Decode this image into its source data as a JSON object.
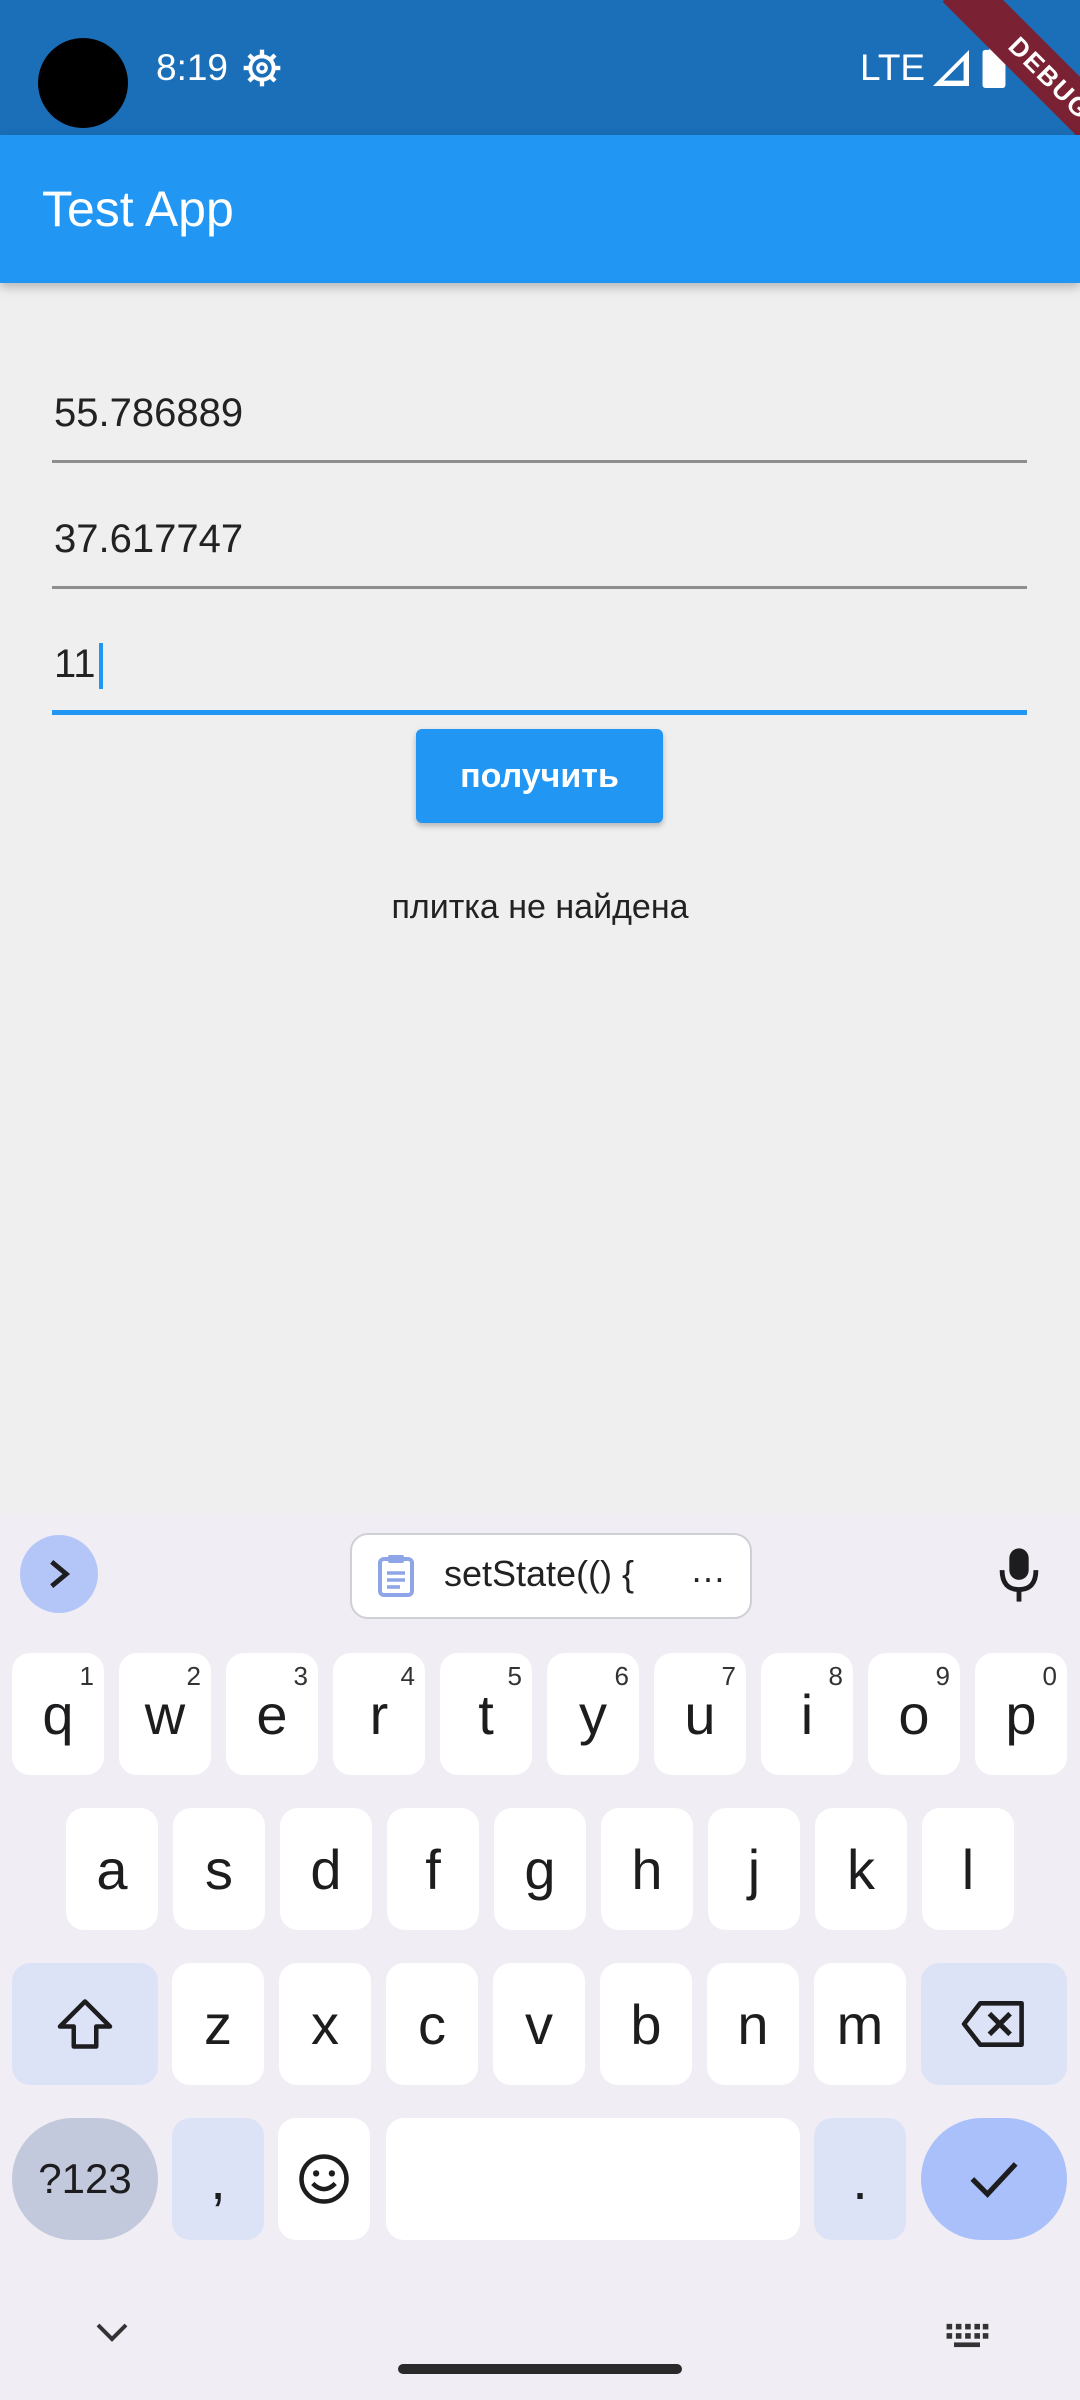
{
  "status_bar": {
    "time": "8:19",
    "network": "LTE",
    "debug_banner": "DEBUG"
  },
  "app_bar": {
    "title": "Test App"
  },
  "form": {
    "latitude": "55.786889",
    "longitude": "37.617747",
    "zoom": "11",
    "submit_label": "получить"
  },
  "result": {
    "message": "плитка не найдена"
  },
  "keyboard": {
    "clipboard_suggestion": "setState(() {",
    "clipboard_more": "…",
    "row1": [
      {
        "k": "q",
        "n": "1"
      },
      {
        "k": "w",
        "n": "2"
      },
      {
        "k": "e",
        "n": "3"
      },
      {
        "k": "r",
        "n": "4"
      },
      {
        "k": "t",
        "n": "5"
      },
      {
        "k": "y",
        "n": "6"
      },
      {
        "k": "u",
        "n": "7"
      },
      {
        "k": "i",
        "n": "8"
      },
      {
        "k": "o",
        "n": "9"
      },
      {
        "k": "p",
        "n": "0"
      }
    ],
    "row2": [
      "a",
      "s",
      "d",
      "f",
      "g",
      "h",
      "j",
      "k",
      "l"
    ],
    "row3": [
      "z",
      "x",
      "c",
      "v",
      "b",
      "n",
      "m"
    ],
    "symbols_label": "?123",
    "comma": ",",
    "period": "."
  }
}
